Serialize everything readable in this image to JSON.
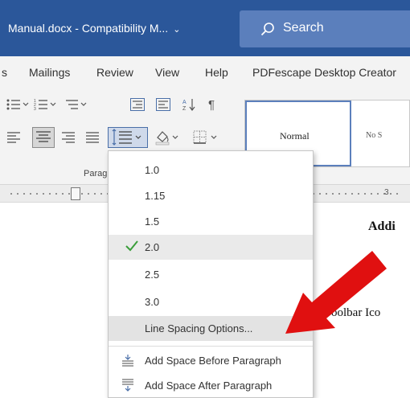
{
  "titlebar": {
    "title": "Manual.docx  -  Compatibility M...",
    "search_placeholder": "Search"
  },
  "menubar": {
    "items": [
      "s",
      "Mailings",
      "Review",
      "View",
      "Help",
      "PDFescape Desktop Creator"
    ]
  },
  "ribbon": {
    "group_label": "Parag",
    "styles": {
      "normal": "Normal",
      "no_spacing": "No S"
    }
  },
  "ruler": {
    "number": "3"
  },
  "document": {
    "heading": "Addi",
    "body": "oolbar Ico"
  },
  "dropdown": {
    "options": [
      "1.0",
      "1.15",
      "1.5",
      "2.0",
      "2.5",
      "3.0",
      "Line Spacing Options..."
    ],
    "selected": "2.0",
    "add_space_before": "Add Space Before Paragraph",
    "add_space_after": "Add Space After Paragraph"
  },
  "colors": {
    "titlebar": "#2b579a",
    "checkmark": "#3a9e3a",
    "arrow": "#e01010"
  }
}
